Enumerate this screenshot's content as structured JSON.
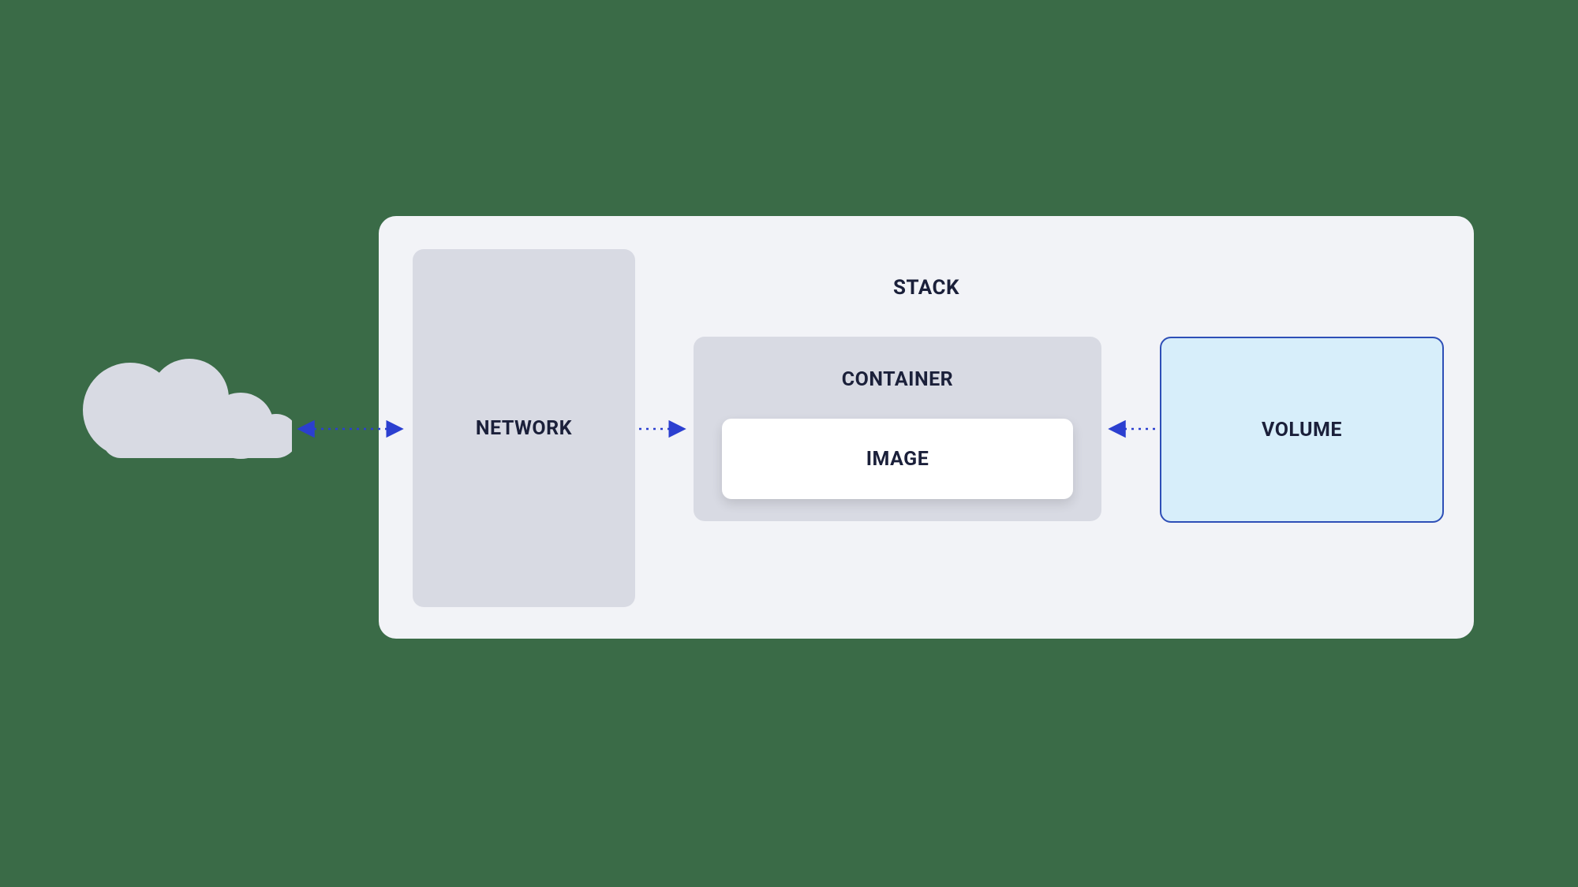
{
  "diagram": {
    "stack_label": "STACK",
    "network_label": "NETWORK",
    "container_label": "CONTAINER",
    "image_label": "IMAGE",
    "volume_label": "VOLUME"
  },
  "colors": {
    "background": "#3a6b47",
    "panel": "#f2f3f7",
    "box_gray": "#d8dae3",
    "box_white": "#ffffff",
    "box_blue": "#d7eefa",
    "border_blue": "#2e4fb7",
    "arrow": "#2b3fd0",
    "cloud": "#d8dae3",
    "text": "#1b203a"
  },
  "connections": [
    {
      "from": "cloud",
      "to": "network",
      "type": "bidirectional"
    },
    {
      "from": "network",
      "to": "container",
      "type": "unidirectional"
    },
    {
      "from": "volume",
      "to": "container",
      "type": "unidirectional"
    }
  ]
}
